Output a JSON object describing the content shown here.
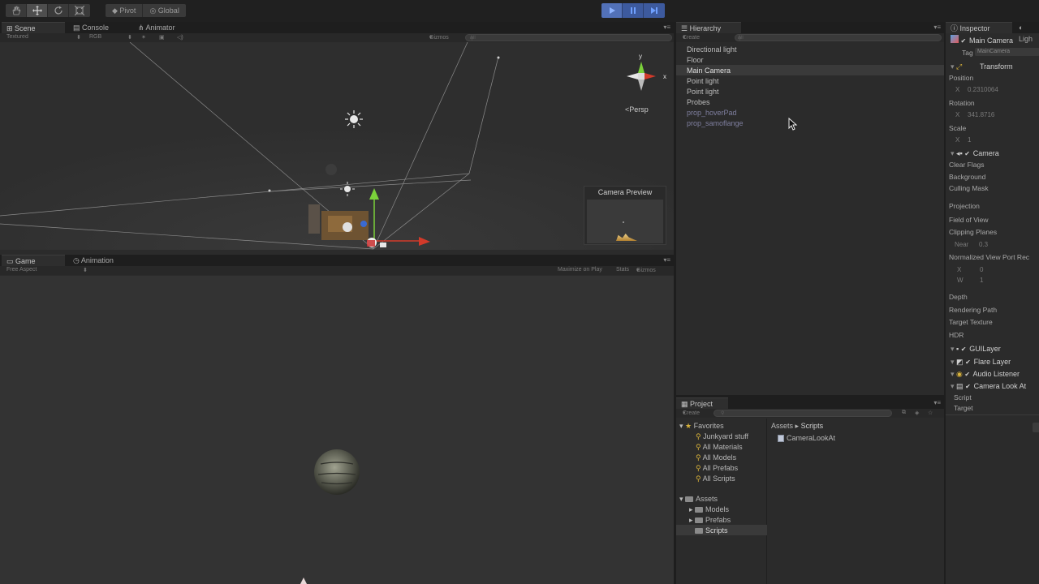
{
  "toolbar": {
    "tools": [
      "hand-icon",
      "move-icon",
      "rotate-icon",
      "scale-icon"
    ],
    "pivot": "Pivot",
    "global": "Global",
    "play_controls": [
      "play-icon",
      "pause-icon",
      "step-icon"
    ]
  },
  "scene": {
    "tabs": [
      "Scene",
      "Console",
      "Animator"
    ],
    "render_mode": "Textured",
    "color_mode": "RGB",
    "gizmos": "Gizmos",
    "search_placeholder": "All",
    "persp_label": "Persp",
    "axis_y": "y",
    "axis_x": "x",
    "camera_preview_title": "Camera Preview"
  },
  "game": {
    "tabs": [
      "Game",
      "Animation"
    ],
    "aspect": "Free Aspect",
    "maximize_on_play": "Maximize on Play",
    "stats": "Stats",
    "gizmos": "Gizmos"
  },
  "hierarchy": {
    "title": "Hierarchy",
    "create": "Create",
    "search_placeholder": "All",
    "items": [
      {
        "label": "Directional light",
        "prefab": false
      },
      {
        "label": "Floor",
        "prefab": false
      },
      {
        "label": "Main Camera",
        "prefab": false,
        "selected": true
      },
      {
        "label": "Point light",
        "prefab": false
      },
      {
        "label": "Point light",
        "prefab": false
      },
      {
        "label": "Probes",
        "prefab": false
      },
      {
        "label": "prop_hoverPad",
        "prefab": true
      },
      {
        "label": "prop_samoflange",
        "prefab": true
      }
    ]
  },
  "project": {
    "title": "Project",
    "create": "Create",
    "favorites_label": "Favorites",
    "favorites": [
      "Junkyard stuff",
      "All Materials",
      "All Models",
      "All Prefabs",
      "All Scripts"
    ],
    "assets_label": "Assets",
    "asset_folders": [
      "Models",
      "Prefabs",
      "Scripts"
    ],
    "breadcrumb": [
      "Assets",
      "Scripts"
    ],
    "files": [
      "CameraLookAt"
    ]
  },
  "inspector": {
    "tabs": [
      "Inspector",
      "Ligh"
    ],
    "object_name": "Main Camera",
    "tag_label": "Tag",
    "tag_value": "MainCamera",
    "transform": {
      "title": "Transform",
      "position_label": "Position",
      "position_x_label": "X",
      "position_x": "0.2310064",
      "rotation_label": "Rotation",
      "rotation_x_label": "X",
      "rotation_x": "341.8716",
      "scale_label": "Scale",
      "scale_x_label": "X",
      "scale_x": "1"
    },
    "camera": {
      "title": "Camera",
      "clear_flags": "Clear Flags",
      "background": "Background",
      "culling_mask": "Culling Mask",
      "projection": "Projection",
      "fov": "Field of View",
      "clipping_planes": "Clipping Planes",
      "near_label": "Near",
      "near_value": "0.3",
      "viewport_rect": "Normalized View Port Rec",
      "viewport_x_label": "X",
      "viewport_x": "0",
      "viewport_w_label": "W",
      "viewport_w": "1",
      "depth": "Depth",
      "rendering_path": "Rendering Path",
      "target_texture": "Target Texture",
      "hdr": "HDR"
    },
    "components": [
      "GUILayer",
      "Flare Layer",
      "Audio Listener",
      "Camera Look At"
    ],
    "script_label": "Script",
    "target_label": "Target"
  },
  "colors": {
    "accent_play": "#3d5a9e",
    "gizmo_green": "#7bd13a",
    "gizmo_red": "#d23a2a",
    "gizmo_blue": "#3a6ad2",
    "folder_yellow": "#d8b23a"
  }
}
